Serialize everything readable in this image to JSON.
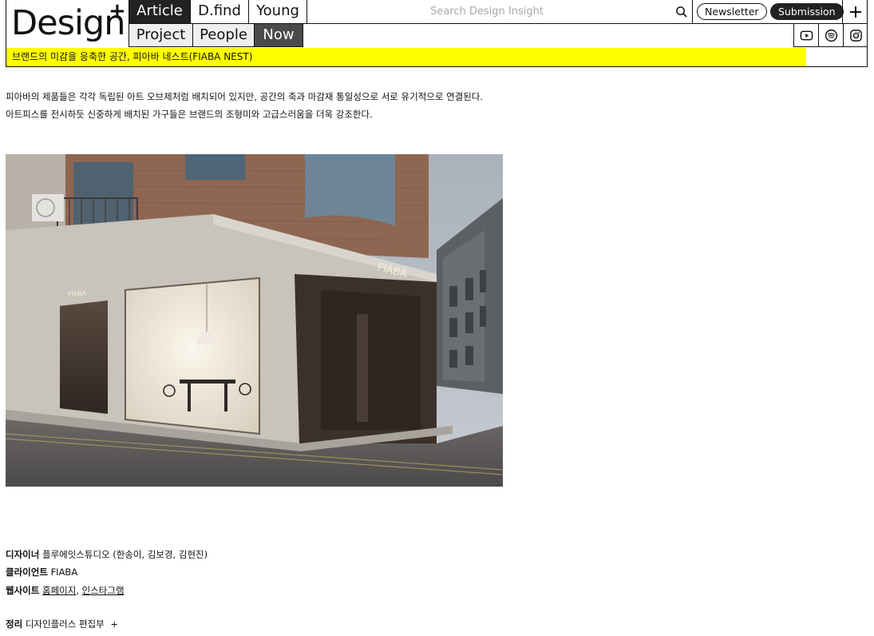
{
  "logo": {
    "text": "Design",
    "plus": "+"
  },
  "nav": {
    "row1": [
      "Article",
      "D.find",
      "Young"
    ],
    "row2": [
      "Project",
      "People",
      "Now"
    ]
  },
  "search": {
    "placeholder": "Search Design Insight",
    "value": ""
  },
  "header_actions": {
    "newsletter": "Newsletter",
    "submission": "Submission",
    "plus": "+"
  },
  "social": [
    "youtube-icon",
    "spotify-icon",
    "instagram-icon"
  ],
  "ticker": "브랜드의 미감을 응축한 공간, 피아바 네스트(FIABA NEST)",
  "article": {
    "para1": "피아바의 제품들은 각각 독립된 아트 오브제처럼 배치되어 있지만, 공간의 축과 마감재 통일성으로 서로 유기적으로 연결된다.",
    "para2": "아트피스를 전시하듯 신중하게 배치된 가구들은 브랜드의 조형미와 고급스러움을 더욱 강조한다.",
    "photo_signage": "FIABA",
    "credits": {
      "designer_label": "디자이너",
      "designer_value": "플루에잇스튜디오 (한송이, 김보경, 김현진)",
      "client_label": "클라이언트",
      "client_value": "FIABA",
      "website_label": "웹사이트",
      "website_link1": "홈페이지",
      "website_sep": ",",
      "website_link2": "인스타그램",
      "editor_label": "정리",
      "editor_value": "디자인플러스 편집부",
      "editor_plus": "+"
    }
  },
  "colors": {
    "ticker_bg": "#ffff00",
    "nav_active": "#222222",
    "nav_now": "#4a4a4a"
  }
}
